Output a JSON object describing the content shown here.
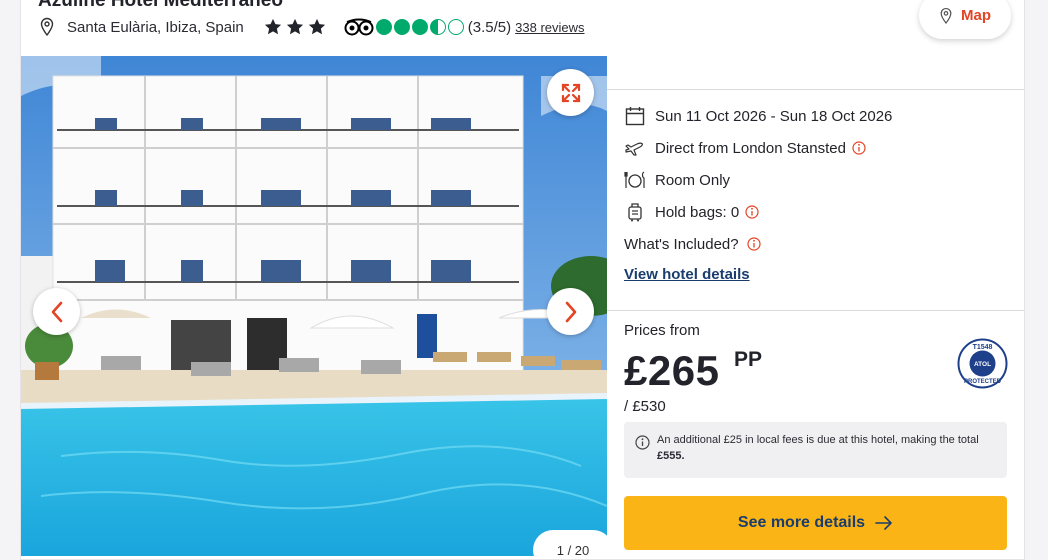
{
  "hotel": {
    "name": "Azuline Hotel Mediterraneo",
    "location": "Santa Eulària, Ibiza, Spain",
    "star_rating": 3,
    "tripadvisor": {
      "bubbles": 3.5,
      "rating_text": "(3.5/5)",
      "reviews_text": "338 reviews"
    }
  },
  "map_button": {
    "label": "Map",
    "icon": "map-pin-icon"
  },
  "gallery": {
    "counter": "1 / 20",
    "icons": {
      "expand": "expand-icon",
      "prev": "chevron-left-icon",
      "next": "chevron-right-icon"
    }
  },
  "details": {
    "dates": "Sun 11 Oct 2026 - Sun 18 Oct 2026",
    "flight": "Direct from London Stansted",
    "board": "Room Only",
    "bags": "Hold bags: 0",
    "included": "What's Included?",
    "view_link": "View hotel details"
  },
  "pricing": {
    "prices_from": "Prices from",
    "price": "£265",
    "pp": "PP",
    "total": "/ £530",
    "fee_text_prefix": "An additional £25 in local fees is due at this hotel, making the total ",
    "fee_total": "£555.",
    "atol": {
      "number": "T1548",
      "line1": "ATOL",
      "line2": "PROTECTED"
    },
    "cta_label": "See more details"
  },
  "colors": {
    "accent": "#e34423",
    "cta": "#fbb415",
    "link": "#1a3d6d",
    "tripadvisor": "#00aa6c"
  }
}
